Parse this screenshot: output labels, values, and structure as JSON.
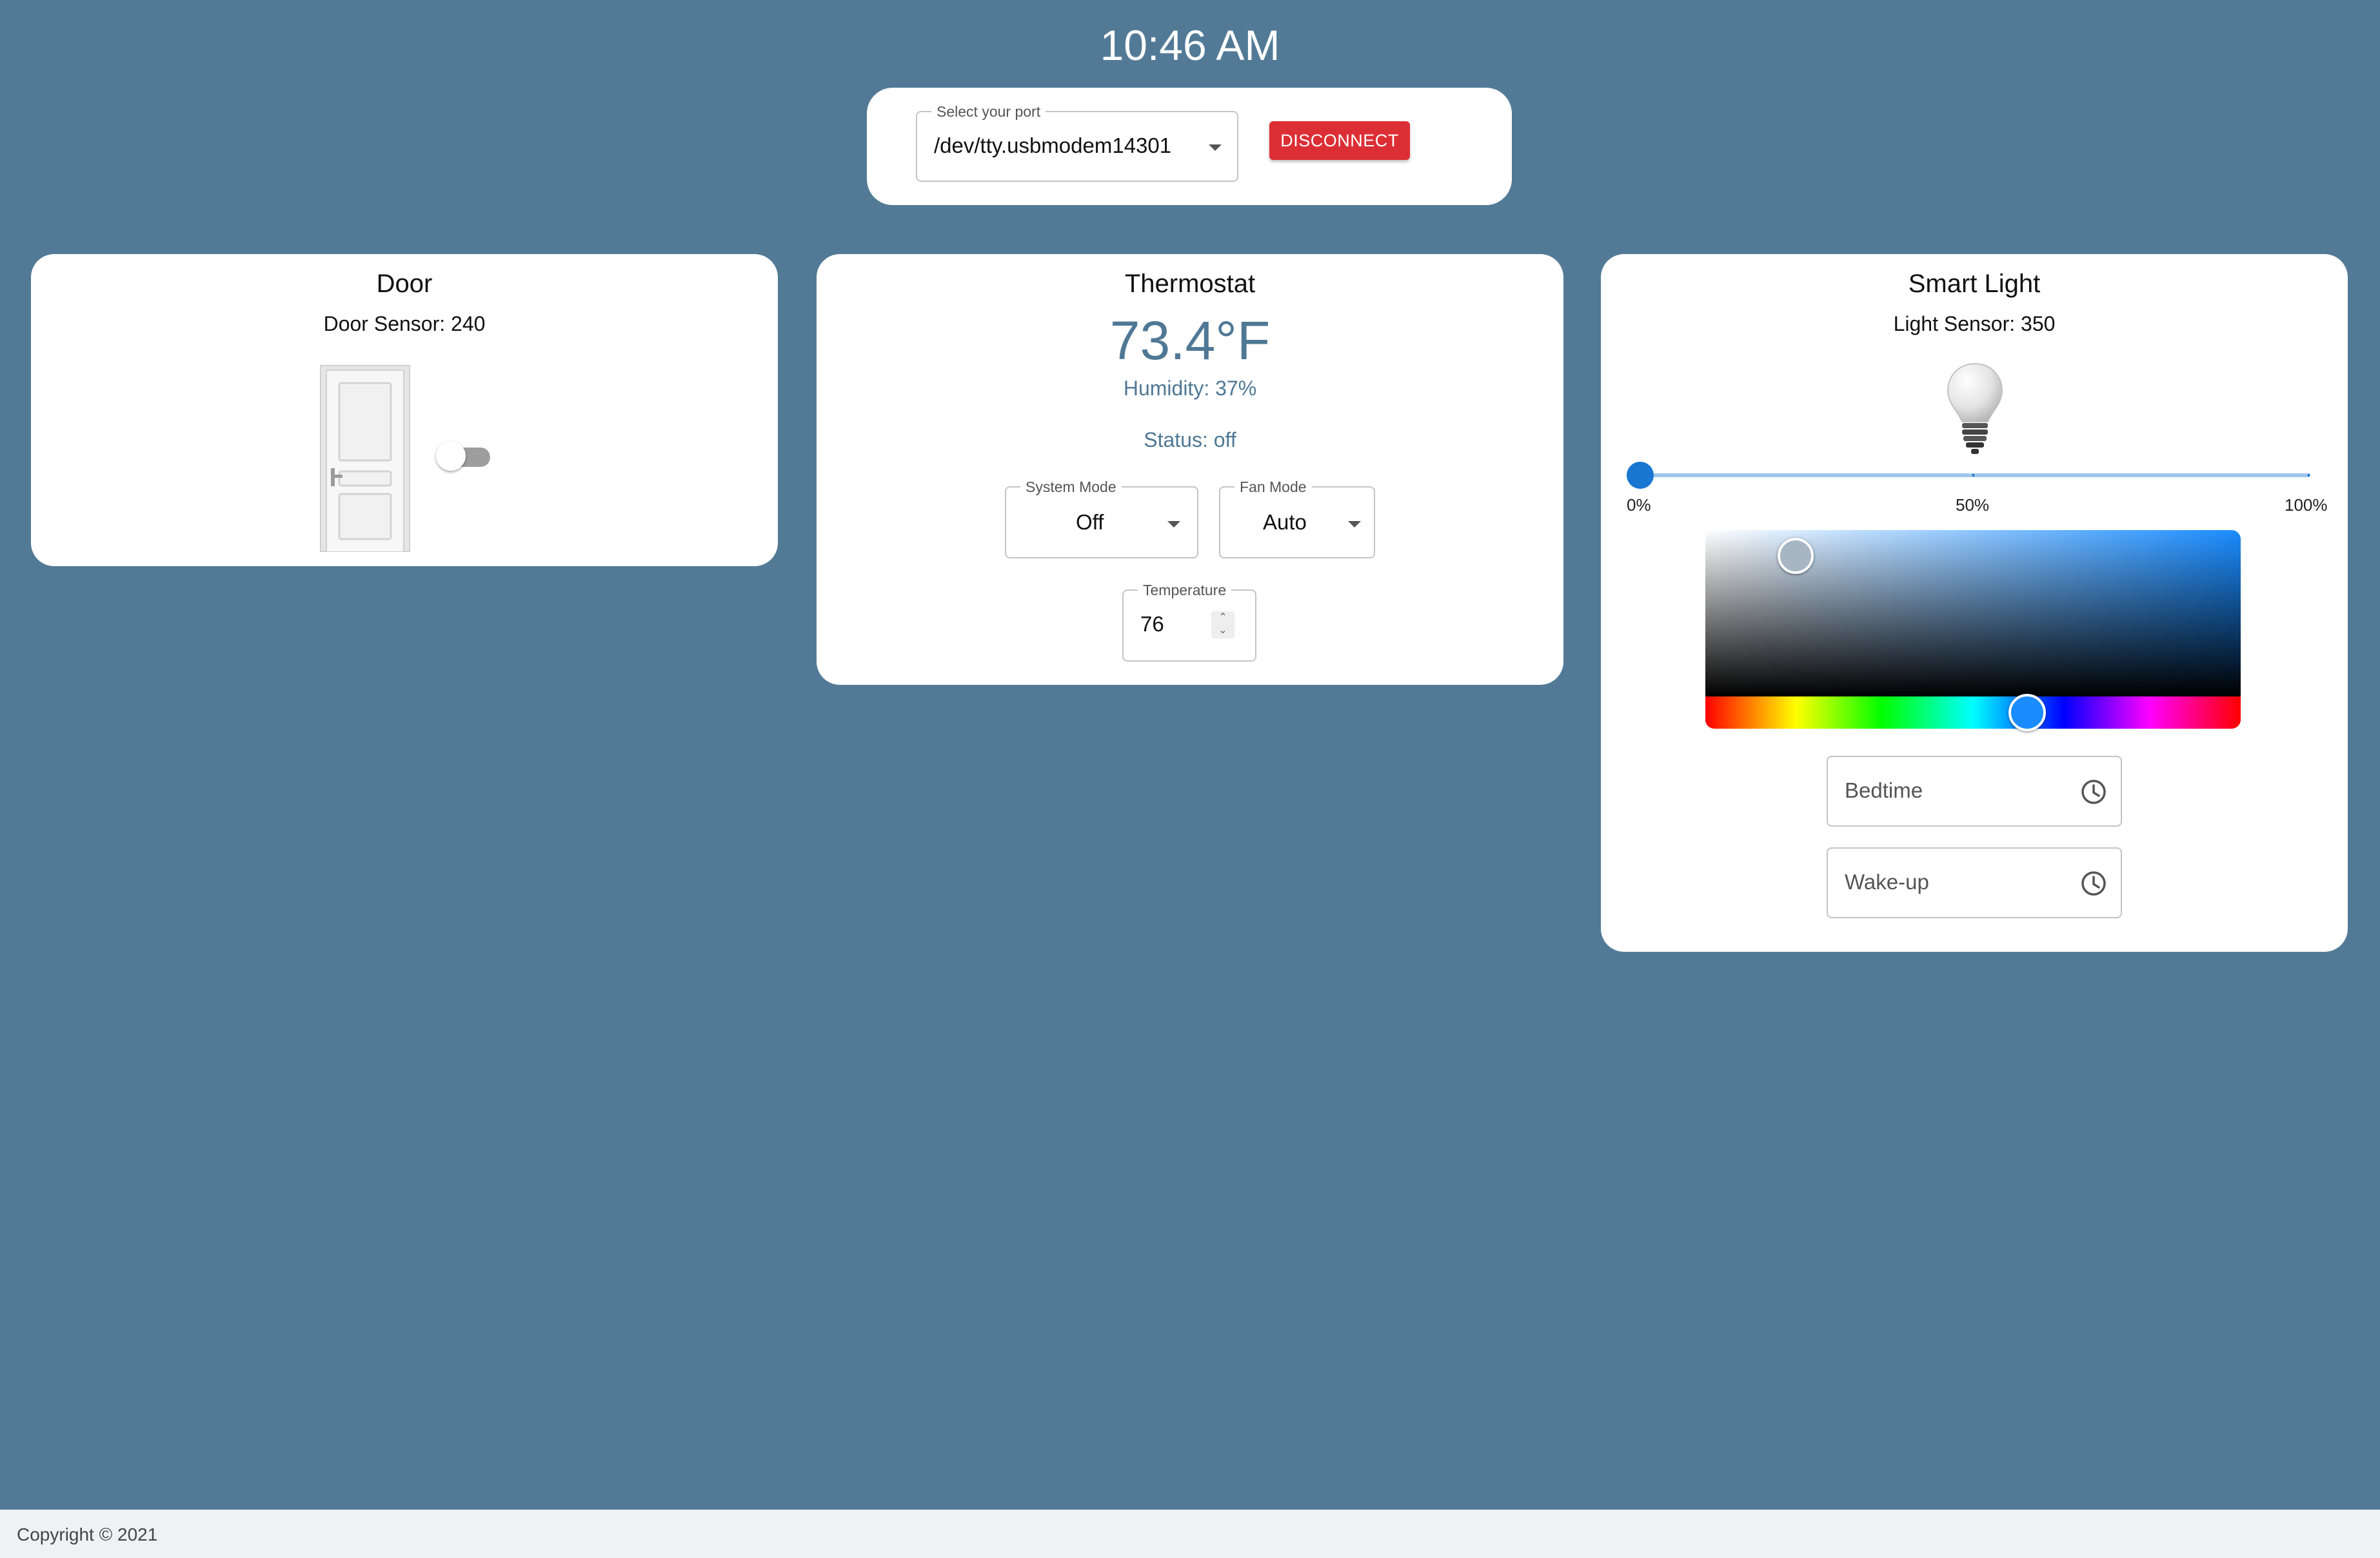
{
  "clock": "10:46 AM",
  "port": {
    "label": "Select your port",
    "value": "/dev/tty.usbmodem14301",
    "disconnect_label": "DISCONNECT"
  },
  "door": {
    "title": "Door",
    "sensor_text": "Door Sensor: 240",
    "toggle_on": false
  },
  "thermostat": {
    "title": "Thermostat",
    "temperature": "73.4°F",
    "humidity": "Humidity: 37%",
    "status": "Status: off",
    "system_mode": {
      "label": "System Mode",
      "value": "Off"
    },
    "fan_mode": {
      "label": "Fan Mode",
      "value": "Auto"
    },
    "target_temp": {
      "label": "Temperature",
      "value": "76"
    }
  },
  "smart_light": {
    "title": "Smart Light",
    "sensor_text": "Light Sensor: 350",
    "brightness": 0,
    "slider_labels": {
      "min": "0%",
      "mid": "50%",
      "max": "100%"
    },
    "color": "#1a8cff",
    "bedtime_placeholder": "Bedtime",
    "wakeup_placeholder": "Wake-up"
  },
  "footer": {
    "copyright": "Copyright © 2021"
  },
  "colors": {
    "background": "#527a96",
    "accent": "#1976d2",
    "danger": "#dc2f35",
    "thermo_text": "#4f7895"
  }
}
